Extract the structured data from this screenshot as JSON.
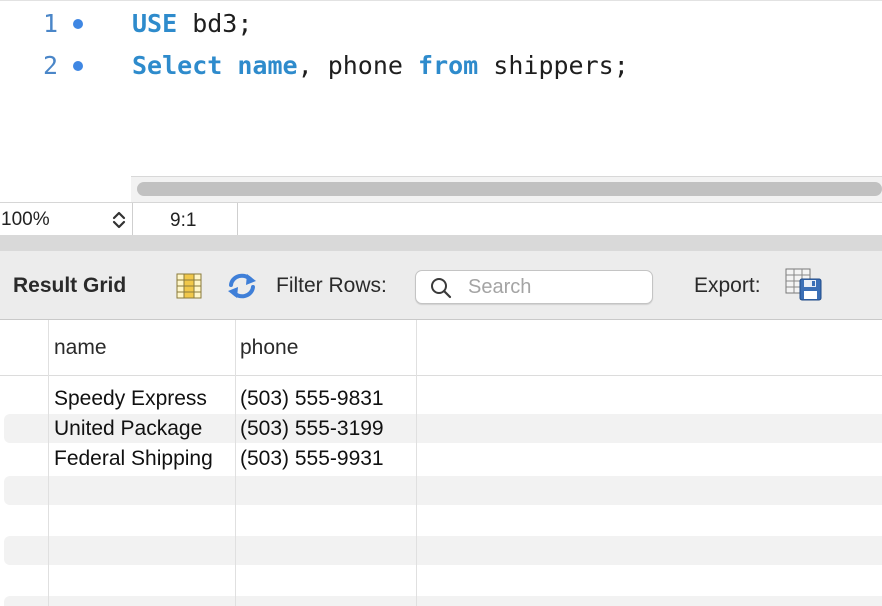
{
  "editor": {
    "lines": [
      {
        "number": "1",
        "tokens": [
          {
            "text": "USE",
            "kw": true
          },
          {
            "text": " bd3;",
            "kw": false
          }
        ]
      },
      {
        "number": "2",
        "tokens": [
          {
            "text": "Select",
            "kw": true
          },
          {
            "text": " ",
            "kw": false
          },
          {
            "text": "name",
            "kw": true
          },
          {
            "text": ", phone ",
            "kw": false
          },
          {
            "text": "from",
            "kw": true
          },
          {
            "text": " shippers;",
            "kw": false
          }
        ]
      }
    ]
  },
  "status": {
    "zoom": "100%",
    "cursor_position": "9:1"
  },
  "toolbar": {
    "result_grid_label": "Result Grid",
    "filter_rows_label": "Filter Rows:",
    "search_placeholder": "Search",
    "export_label": "Export:",
    "icons": [
      "grid-view-icon",
      "refresh-icon",
      "search-icon",
      "export-icon"
    ]
  },
  "grid": {
    "columns": [
      "name",
      "phone"
    ],
    "rows": [
      [
        "Speedy Express",
        "(503) 555-9831"
      ],
      [
        "United Package",
        "(503) 555-3199"
      ],
      [
        "Federal Shipping",
        "(503) 555-9931"
      ]
    ]
  },
  "colors": {
    "keyword": "#2e8bcc",
    "line_number": "#4a86c8",
    "breakpoint_dot": "#3f87e3",
    "refresh_icon": "#3f7fd8",
    "toolbar_bg": "#ececec"
  }
}
